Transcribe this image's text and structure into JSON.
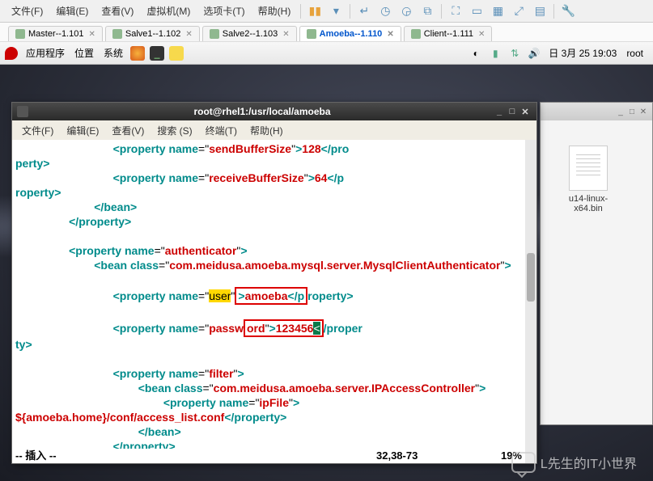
{
  "vm_menu": [
    "文件(F)",
    "编辑(E)",
    "查看(V)",
    "虚拟机(M)",
    "选项卡(T)",
    "帮助(H)"
  ],
  "vm_tabs": [
    {
      "label": "Master--1.101",
      "active": false
    },
    {
      "label": "Salve1--1.102",
      "active": false
    },
    {
      "label": "Salve2--1.103",
      "active": false
    },
    {
      "label": "Amoeba--1.110",
      "active": true
    },
    {
      "label": "Client--1.111",
      "active": false
    }
  ],
  "desktop": {
    "apps": "应用程序",
    "places": "位置",
    "system": "系统",
    "date": "日 3月 25 19:03",
    "user": "root"
  },
  "desktop_file": "u14-linux-x64.bin",
  "terminal": {
    "title": "root@rhel1:/usr/local/amoeba",
    "menu": [
      "文件(F)",
      "编辑(E)",
      "查看(V)",
      "搜索 (S)",
      "终端(T)",
      "帮助(H)"
    ],
    "props": {
      "sendBuf": {
        "name": "sendBufferSize",
        "val": "128"
      },
      "recvBuf": {
        "name": "receiveBufferSize",
        "val": "64"
      },
      "auth": {
        "name": "authenticator"
      },
      "auth_class": "com.meidusa.amoeba.mysql.server.MysqlClientAuthenticator",
      "user": {
        "name": "user",
        "val": "amoeba"
      },
      "pass": {
        "name": "password",
        "val": "123456"
      },
      "filter": {
        "name": "filter"
      },
      "filter_class": "com.meidusa.amoeba.server.IPAccessController",
      "ipfile": {
        "name": "ipFile"
      },
      "ipfile_val": "${amoeba.home}/conf/access_list.conf"
    },
    "mode": "-- 插入 --",
    "pos": "32,38-73",
    "pct": "19%"
  },
  "watermark": "L先生的IT小世界"
}
